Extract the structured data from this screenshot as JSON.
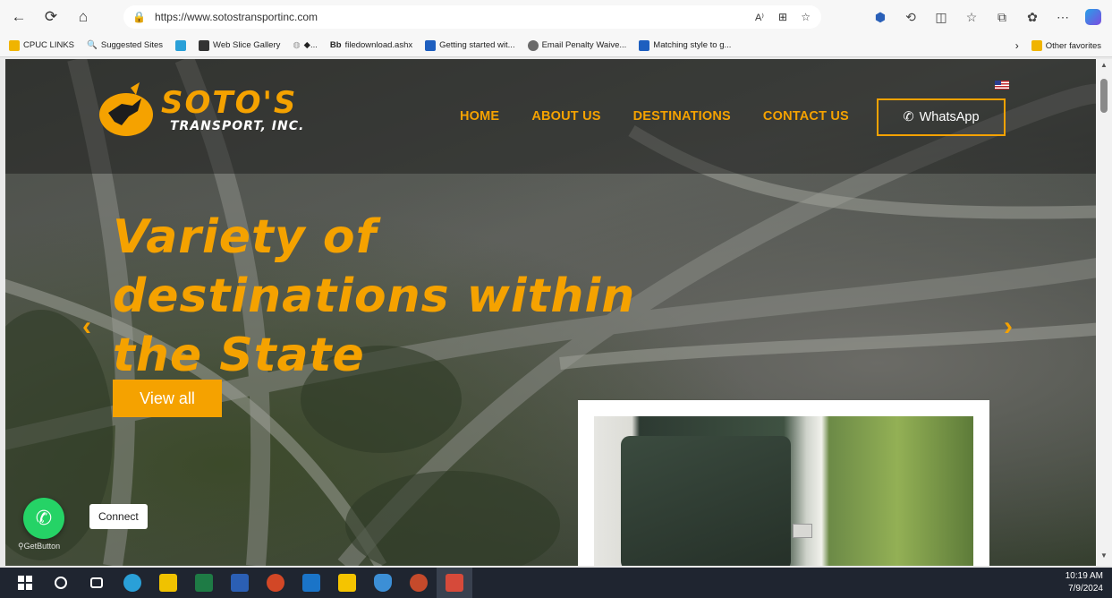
{
  "browser": {
    "url": "https://www.sotostransportinc.com",
    "favorites": [
      {
        "label": "CPUC LINKS",
        "color": "#f0b400"
      },
      {
        "label": "Suggested Sites",
        "color": "#2a72c8"
      },
      {
        "label": "",
        "color": "#2aa0d8"
      },
      {
        "label": "Web Slice Gallery",
        "color": "#333333"
      },
      {
        "label": "◆...",
        "color": "#9a9a9a"
      },
      {
        "label": "filedownload.ashx",
        "color": "#222222",
        "prefix": "Bb"
      },
      {
        "label": "Getting started wit...",
        "color": "#1e5fbf"
      },
      {
        "label": "Email Penalty Waive...",
        "color": "#6b6b6b"
      },
      {
        "label": "Matching style to g...",
        "color": "#1e5fbf"
      }
    ],
    "other_favorites": "Other favorites"
  },
  "site": {
    "logo_line1": "SOTO'S",
    "logo_line2": "TRANSPORT, INC.",
    "nav": [
      "HOME",
      "ABOUT US",
      "DESTINATIONS",
      "CONTACT US"
    ],
    "whatsapp_button": "WhatsApp",
    "headline": [
      "Variety of",
      "destinations within",
      "the State"
    ],
    "cta": "View all",
    "connect_label": "Connect",
    "getbutton_label": "GetButton"
  },
  "taskbar": {
    "time": "10:19 AM",
    "date": "7/9/2024",
    "apps": [
      "#2aa0d8",
      "#f0c200",
      "#1e7b45",
      "#2b5fb4",
      "#d24726",
      "#1a74c8",
      "#f5c400",
      "#3c8fd6",
      "#c54a2b",
      "#d64a3a"
    ]
  },
  "colors": {
    "accent": "#f5a200",
    "whatsapp": "#25d366"
  }
}
